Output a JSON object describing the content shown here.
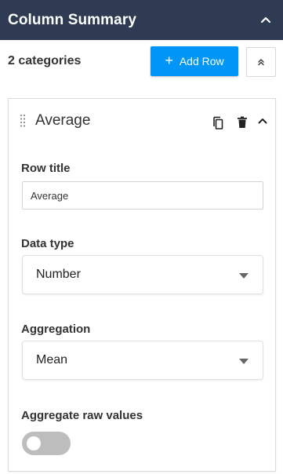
{
  "panel": {
    "title": "Column Summary"
  },
  "toolbar": {
    "category_count": "2 categories",
    "add_row_label": "Add Row",
    "add_row_plus": "+"
  },
  "row": {
    "name": "Average",
    "row_title": {
      "label": "Row title",
      "value": "Average"
    },
    "data_type": {
      "label": "Data type",
      "selected": "Number"
    },
    "aggregation": {
      "label": "Aggregation",
      "selected": "Mean"
    },
    "aggregate_raw": {
      "label": "Aggregate raw values",
      "enabled": false
    }
  },
  "colors": {
    "header_bg": "#2f3b52",
    "accent": "#0095f6",
    "toggle_off": "#bdbdbd"
  },
  "icons": [
    "chevron-up-icon",
    "double-chevron-up-icon",
    "drag-handle-icon",
    "copy-icon",
    "trash-icon",
    "caret-down-icon"
  ]
}
